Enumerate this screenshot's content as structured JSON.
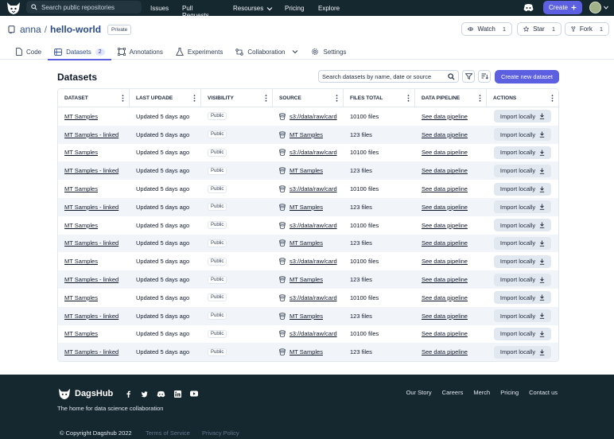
{
  "topnav": {
    "search_placeholder": "Search public repositories",
    "links": [
      "Issues",
      "Pull Requests",
      "Resourses",
      "Pricing",
      "Explore"
    ],
    "create_label": "Create"
  },
  "repo": {
    "owner": "anna",
    "separator": "/",
    "name": "hello-world",
    "badge": "Private",
    "watch_label": "Watch",
    "watch_count": "1",
    "star_label": "Star",
    "star_count": "1",
    "fork_label": "Fork",
    "fork_count": "1"
  },
  "tabs": {
    "code": "Code",
    "datasets": "Datasets",
    "datasets_count": "2",
    "annotations": "Annotations",
    "experiments": "Experiments",
    "collaboration": "Collaboration",
    "settings": "Settings"
  },
  "datasets": {
    "title": "Datasets",
    "search_placeholder": "Search datasets by name, date or source",
    "create_button": "Create new dataset",
    "columns": [
      "DATASET",
      "LAST UPDADE",
      "VISIBILITY",
      "SOURCE",
      "FILES TOTAL",
      "DATA PIPELINE",
      "ACTIONS"
    ],
    "rows": [
      {
        "name": "MT Samples",
        "updated": "Updated 5 days ago",
        "visibility": "Public",
        "source": "s3://data/raw/card",
        "files": "10100 files",
        "pipeline": "See data pipeline",
        "action": "Import locally"
      },
      {
        "name": "MT Samples - linked",
        "updated": "Updated 5 days ago",
        "visibility": "Public",
        "source": "MT Samples",
        "files": "123 files",
        "pipeline": "See data pipeline",
        "action": "Import locally"
      },
      {
        "name": "MT Samples",
        "updated": "Updated 5 days ago",
        "visibility": "Public",
        "source": "s3://data/raw/card",
        "files": "10100 files",
        "pipeline": "See data pipeline",
        "action": "Import locally"
      },
      {
        "name": "MT Samples - linked",
        "updated": "Updated 5 days ago",
        "visibility": "Public",
        "source": "MT Samples",
        "files": "123 files",
        "pipeline": "See data pipeline",
        "action": "Import locally"
      },
      {
        "name": "MT Samples",
        "updated": "Updated 5 days ago",
        "visibility": "Public",
        "source": "s3://data/raw/card",
        "files": "10100 files",
        "pipeline": "See data pipeline",
        "action": "Import locally"
      },
      {
        "name": "MT Samples - linked",
        "updated": "Updated 5 days ago",
        "visibility": "Public",
        "source": "MT Samples",
        "files": "123 files",
        "pipeline": "See data pipeline",
        "action": "Import locally"
      },
      {
        "name": "MT Samples",
        "updated": "Updated 5 days ago",
        "visibility": "Public",
        "source": "s3://data/raw/card",
        "files": "10100 files",
        "pipeline": "See data pipeline",
        "action": "Import locally"
      },
      {
        "name": "MT Samples - linked",
        "updated": "Updated 5 days ago",
        "visibility": "Public",
        "source": "MT Samples",
        "files": "123 files",
        "pipeline": "See data pipeline",
        "action": "Import locally"
      },
      {
        "name": "MT Samples",
        "updated": "Updated 5 days ago",
        "visibility": "Public",
        "source": "s3://data/raw/card",
        "files": "10100 files",
        "pipeline": "See data pipeline",
        "action": "Import locally"
      },
      {
        "name": "MT Samples - linked",
        "updated": "Updated 5 days ago",
        "visibility": "Public",
        "source": "MT Samples",
        "files": "123 files",
        "pipeline": "See data pipeline",
        "action": "Import locally"
      },
      {
        "name": "MT Samples",
        "updated": "Updated 5 days ago",
        "visibility": "Public",
        "source": "s3://data/raw/card",
        "files": "10100 files",
        "pipeline": "See data pipeline",
        "action": "Import locally"
      },
      {
        "name": "MT Samples - linked",
        "updated": "Updated 5 days ago",
        "visibility": "Public",
        "source": "MT Samples",
        "files": "123 files",
        "pipeline": "See data pipeline",
        "action": "Import locally"
      },
      {
        "name": "MT Samples",
        "updated": "Updated 5 days ago",
        "visibility": "Public",
        "source": "s3://data/raw/card",
        "files": "10100 files",
        "pipeline": "See data pipeline",
        "action": "Import locally"
      },
      {
        "name": "MT Samples - linked",
        "updated": "Updated 5 days ago",
        "visibility": "Public",
        "source": "MT Samples",
        "files": "123 files",
        "pipeline": "See data pipeline",
        "action": "Import locally"
      }
    ]
  },
  "footer": {
    "brand": "DagsHub",
    "tagline": "The home for data science collaboration",
    "links": [
      "Our Story",
      "Careers",
      "Merch",
      "Pricing",
      "Contact us"
    ],
    "copyright": "© Copyright Dagshub 2022",
    "terms": "Terms of Service",
    "privacy": "Privacy Policy"
  },
  "colors": {
    "nav_bg": "#15272f",
    "accent": "#5b5fe0",
    "repo_link": "#2c4b8a",
    "row_alt": "#f1f5f9"
  }
}
